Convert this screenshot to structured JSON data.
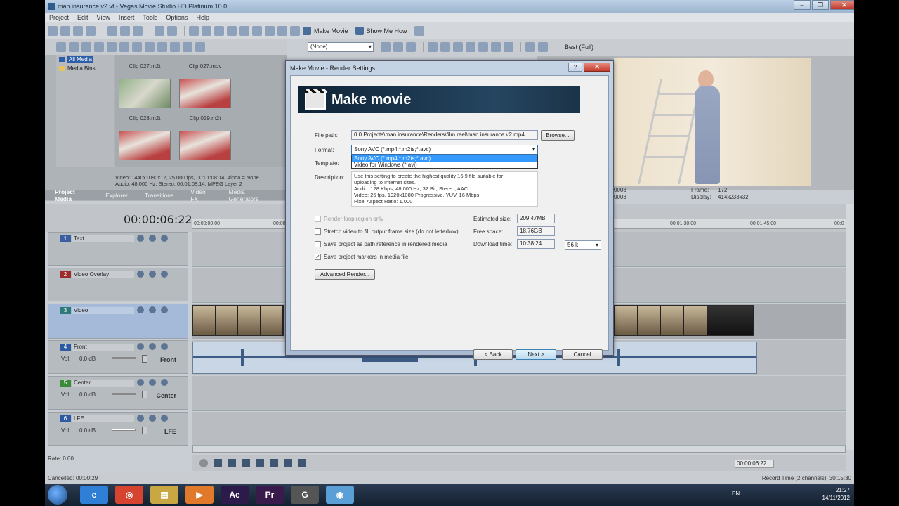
{
  "window": {
    "title": "man insurance v2.vf - Vegas Movie Studio HD Platinum 10.0",
    "minimize": "–",
    "maximize": "❐",
    "close": "✕"
  },
  "menu": [
    "Project",
    "Edit",
    "View",
    "Insert",
    "Tools",
    "Options",
    "Help"
  ],
  "toolbar": {
    "make_movie": "Make Movie",
    "show_me_how": "Show Me How"
  },
  "media": {
    "tree": [
      "All Media",
      "Media Bins"
    ],
    "clips": [
      {
        "label": "Clip 027.m2t"
      },
      {
        "label": "Clip 027.mov"
      },
      {
        "label": "Clip 028.m2t"
      },
      {
        "label": "Clip 029.m2t"
      }
    ],
    "info_line1": "Video: 1440x1080x12, 25.000 fps, 00:01:08:14, Alpha = None",
    "info_line2": "Audio: 48,000 Hz, Stereo, 00:01:08:14, MPEG Layer 2",
    "tabs": [
      "Project Media",
      "Explorer",
      "Transitions",
      "Video FX",
      "Media Generators"
    ]
  },
  "preview": {
    "fx_select": "(None)",
    "quality": "Best (Full)",
    "frame_label": "Frame:",
    "frame_value": "172",
    "display_label": "Display:",
    "display_value": "414x233x32",
    "left_info_1": "0003",
    "left_info_2": "0003"
  },
  "timeline": {
    "timecode": "00:00:06:22",
    "ruler": [
      "00:00:00;00",
      "00:00:15;00",
      "00:01:30;00",
      "00:01:45;00",
      "00:0"
    ],
    "tracks": [
      {
        "num": "1",
        "name": "Text",
        "color": "#3a5fa0"
      },
      {
        "num": "2",
        "name": "Video Overlay",
        "color": "#9c2c2c"
      },
      {
        "num": "3",
        "name": "Video",
        "color": "#2d7a7a"
      },
      {
        "num": "4",
        "name": "Front",
        "color": "#2d5aa0",
        "vol": "Vol:",
        "db": "0.0 dB",
        "label": "Front"
      },
      {
        "num": "5",
        "name": "Center",
        "color": "#3a8a3a",
        "vol": "Vol:",
        "db": "0.0 dB",
        "label": "Center"
      },
      {
        "num": "6",
        "name": "LFE",
        "color": "#2d5aa0",
        "vol": "Vol:",
        "db": "0.0 dB",
        "label": "LFE"
      }
    ],
    "rate": "Rate: 0.00",
    "transport_time": "00:00:06:22"
  },
  "status": {
    "left": "Cancelled: 00:00:29",
    "right": "Record Time (2 channels): 30:15:30"
  },
  "taskbar": {
    "lang": "EN",
    "time": "21:27",
    "date": "14/11/2012",
    "apps": [
      {
        "name": "ie",
        "glyph": "e",
        "color": "#2f7fd6"
      },
      {
        "name": "chrome",
        "glyph": "◎",
        "color": "#d6442f"
      },
      {
        "name": "explorer",
        "glyph": "▤",
        "color": "#e0c05a"
      },
      {
        "name": "media",
        "glyph": "▶",
        "color": "#e07a2a"
      },
      {
        "name": "ae",
        "glyph": "Ae",
        "color": "#2b1a4a"
      },
      {
        "name": "pr",
        "glyph": "Pr",
        "color": "#3a1a4a"
      },
      {
        "name": "app7",
        "glyph": "G",
        "color": "#555"
      },
      {
        "name": "app8",
        "glyph": "◉",
        "color": "#5aa0d6"
      }
    ]
  },
  "dialog": {
    "title": "Make Movie - Render Settings",
    "help": "?",
    "close": "✕",
    "banner": "Make movie",
    "file_path_label": "File path:",
    "file_path": "0.0 Projects\\man insurance\\Renders\\film reel\\man insurance v2.mp4",
    "browse": "Browse...",
    "format_label": "Format:",
    "format_value": "Sony AVC (*.mp4;*.m2ts;*.avc)",
    "format_options": [
      "Sony AVC (*.mp4;*.m2ts;*.avc)",
      "Video for Windows (*.avi)"
    ],
    "template_label": "Template:",
    "description_label": "Description:",
    "description": [
      "Use this setting to create the highest quality 16:9 file suitable for",
      "uploading to Internet sites.",
      "Audio: 128 Kbps, 48,000 Hz, 32 Bit, Stereo, AAC",
      "Video: 25 fps, 1920x1080 Progressive, YUV, 16 Mbps",
      "Pixel Aspect Ratio: 1.000"
    ],
    "checks": [
      {
        "label": "Render loop region only",
        "checked": false,
        "disabled": true
      },
      {
        "label": "Stretch video to fill output frame size (do not letterbox)",
        "checked": false,
        "disabled": false
      },
      {
        "label": "Save project as path reference in rendered media",
        "checked": false,
        "disabled": false
      },
      {
        "label": "Save project markers in media file",
        "checked": true,
        "disabled": false
      }
    ],
    "est_size_label": "Estimated size:",
    "est_size": "209.47MB",
    "free_space_label": "Free space:",
    "free_space": "18.76GB",
    "download_label": "Download time:",
    "download_time": "10:38:24",
    "speed": "56 k",
    "advanced": "Advanced Render...",
    "back": "< Back",
    "next": "Next >",
    "cancel": "Cancel"
  }
}
